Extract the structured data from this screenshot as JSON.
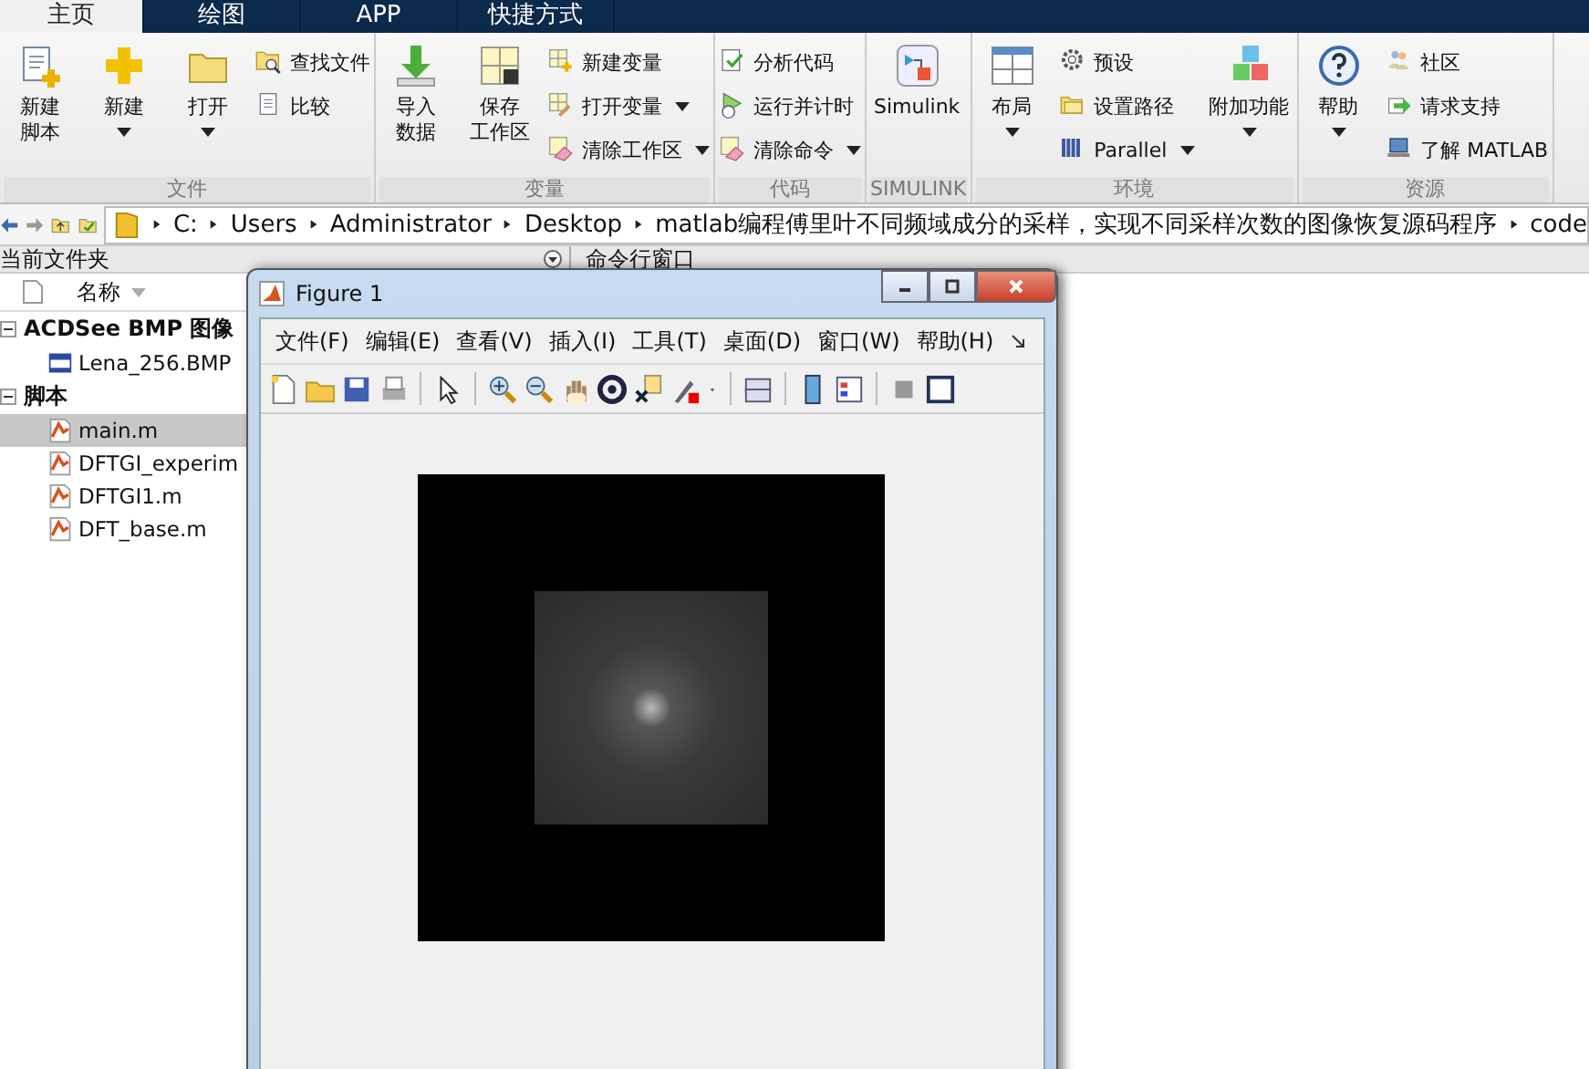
{
  "ribbon": {
    "tabs": [
      {
        "label": "主页",
        "selected": true
      },
      {
        "label": "绘图",
        "selected": false
      },
      {
        "label": "APP",
        "selected": false
      },
      {
        "label": "快捷方式",
        "selected": false
      }
    ],
    "groups": [
      {
        "label": "文件",
        "items": [
          {
            "kind": "large",
            "label": [
              "新建",
              "脚本"
            ],
            "dropdown": false
          },
          {
            "kind": "large",
            "label": "新建",
            "dropdown": true
          },
          {
            "kind": "large",
            "label": "打开",
            "dropdown": true
          },
          {
            "kind": "stack",
            "buttons": [
              {
                "label": "查找文件",
                "dropdown": false
              },
              {
                "label": "比较",
                "dropdown": false
              }
            ]
          }
        ]
      },
      {
        "label": "变量",
        "items": [
          {
            "kind": "large",
            "label": [
              "导入",
              "数据"
            ],
            "dropdown": false
          },
          {
            "kind": "large",
            "label": [
              "保存",
              "工作区"
            ],
            "dropdown": false
          },
          {
            "kind": "stack",
            "buttons": [
              {
                "label": "新建变量",
                "dropdown": false
              },
              {
                "label": "打开变量",
                "dropdown": true
              },
              {
                "label": "清除工作区",
                "dropdown": true
              }
            ]
          }
        ]
      },
      {
        "label": "代码",
        "items": [
          {
            "kind": "stack",
            "buttons": [
              {
                "label": "分析代码",
                "dropdown": false
              },
              {
                "label": "运行并计时",
                "dropdown": false
              },
              {
                "label": "清除命令",
                "dropdown": true
              }
            ]
          }
        ]
      },
      {
        "label": "SIMULINK",
        "items": [
          {
            "kind": "large",
            "label": "Simulink",
            "dropdown": false
          }
        ]
      },
      {
        "label": "环境",
        "items": [
          {
            "kind": "large",
            "label": "布局",
            "dropdown": true
          },
          {
            "kind": "stack",
            "buttons": [
              {
                "label": "预设",
                "dropdown": false
              },
              {
                "label": "设置路径",
                "dropdown": false
              },
              {
                "label": "Parallel",
                "dropdown": true
              }
            ]
          },
          {
            "kind": "large",
            "label": "附加功能",
            "dropdown": true
          }
        ]
      },
      {
        "label": "资源",
        "items": [
          {
            "kind": "large",
            "label": "帮助",
            "dropdown": true
          },
          {
            "kind": "stack",
            "buttons": [
              {
                "label": "社区",
                "dropdown": false
              },
              {
                "label": "请求支持",
                "dropdown": false
              },
              {
                "label": "了解 MATLAB",
                "dropdown": false
              }
            ]
          }
        ]
      }
    ]
  },
  "path_bar": {
    "segments": [
      "C:",
      "Users",
      "Administrator",
      "Desktop",
      "matlab编程傅里叶不同频域成分的采样，实现不同采样次数的图像恢复源码程序",
      "code"
    ]
  },
  "current_folder": {
    "title": "当前文件夹",
    "column": "名称",
    "groups": [
      {
        "label": "ACDSee BMP 图像",
        "expanded": true,
        "children": [
          {
            "name": "Lena_256.BMP",
            "kind": "bmp",
            "selected": false
          }
        ]
      },
      {
        "label": "脚本",
        "expanded": true,
        "children": [
          {
            "name": "main.m",
            "kind": "m",
            "selected": true
          },
          {
            "name": "DFTGI_experim",
            "kind": "m",
            "selected": false
          },
          {
            "name": "DFTGI1.m",
            "kind": "m",
            "selected": false
          },
          {
            "name": "DFT_base.m",
            "kind": "m",
            "selected": false
          }
        ]
      }
    ]
  },
  "command_window": {
    "title": "命令行窗口"
  },
  "figure": {
    "title": "Figure 1",
    "menu": [
      "文件(F)",
      "编辑(E)",
      "查看(V)",
      "插入(I)",
      "工具(T)",
      "桌面(D)",
      "窗口(W)",
      "帮助(H)"
    ]
  }
}
